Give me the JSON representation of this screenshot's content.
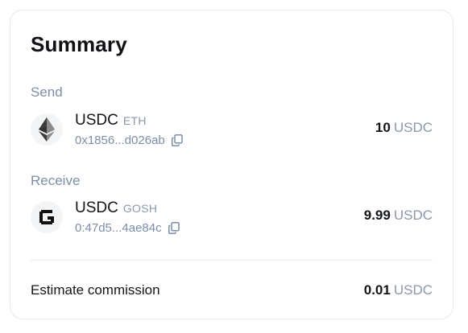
{
  "summary": {
    "title": "Summary",
    "send": {
      "label": "Send",
      "token": "USDC",
      "chain": "ETH",
      "address": "0x1856...d026ab",
      "amount": "10",
      "unit": "USDC",
      "icon": "ethereum-logo-icon"
    },
    "receive": {
      "label": "Receive",
      "token": "USDC",
      "chain": "GOSH",
      "address": "0:47d5...4ae84c",
      "amount": "9.99",
      "unit": "USDC",
      "icon": "gosh-logo-icon"
    },
    "commission": {
      "label": "Estimate commission",
      "amount": "0.01",
      "unit": "USDC"
    }
  },
  "colors": {
    "muted": "#7b8ea8",
    "border": "#e6e9ee",
    "text": "#111418"
  }
}
